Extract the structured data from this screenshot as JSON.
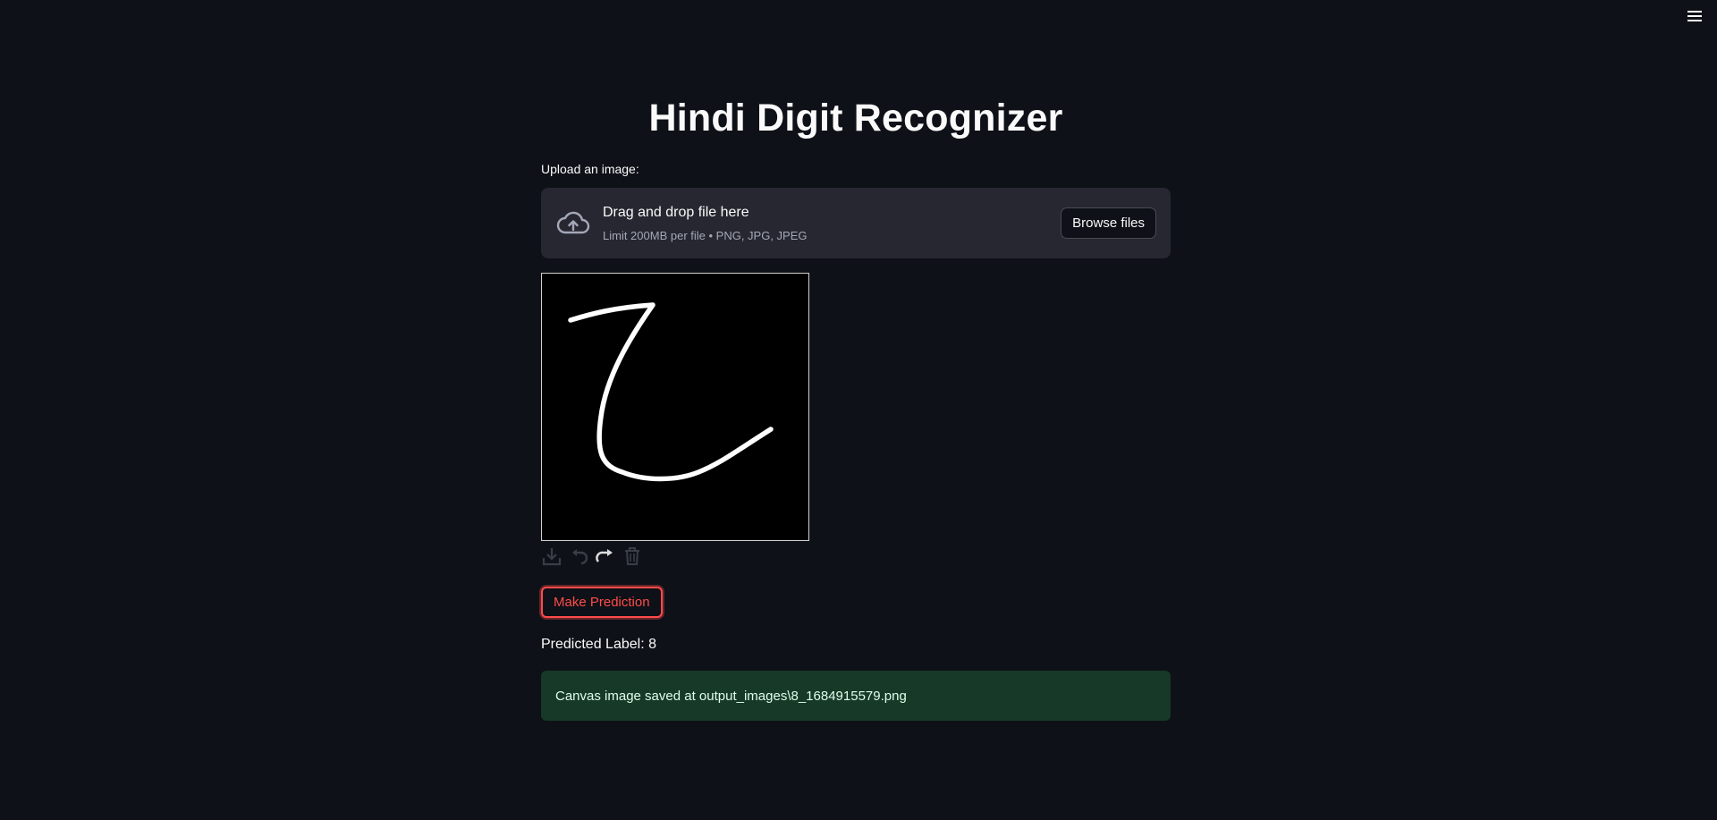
{
  "header": {
    "menu_icon": "hamburger-menu-icon"
  },
  "main": {
    "title": "Hindi Digit Recognizer",
    "upload": {
      "label": "Upload an image:",
      "drop_title": "Drag and drop file here",
      "drop_subtitle": "Limit 200MB per file • PNG, JPG, JPEG",
      "browse_label": "Browse files",
      "icon": "cloud-upload-icon"
    },
    "canvas": {
      "background": "#000000",
      "stroke_color": "#ffffff",
      "tools": [
        "download-icon",
        "undo-icon",
        "redo-icon",
        "trash-icon"
      ]
    },
    "predict_button": "Make Prediction",
    "predicted_label": "Predicted Label: 8",
    "success_message": "Canvas image saved at output_images\\8_1684915579.png"
  },
  "colors": {
    "background": "#0e1117",
    "primary": "#ff4b4b",
    "dropzone": "#262730",
    "success_bg": "#173928"
  }
}
